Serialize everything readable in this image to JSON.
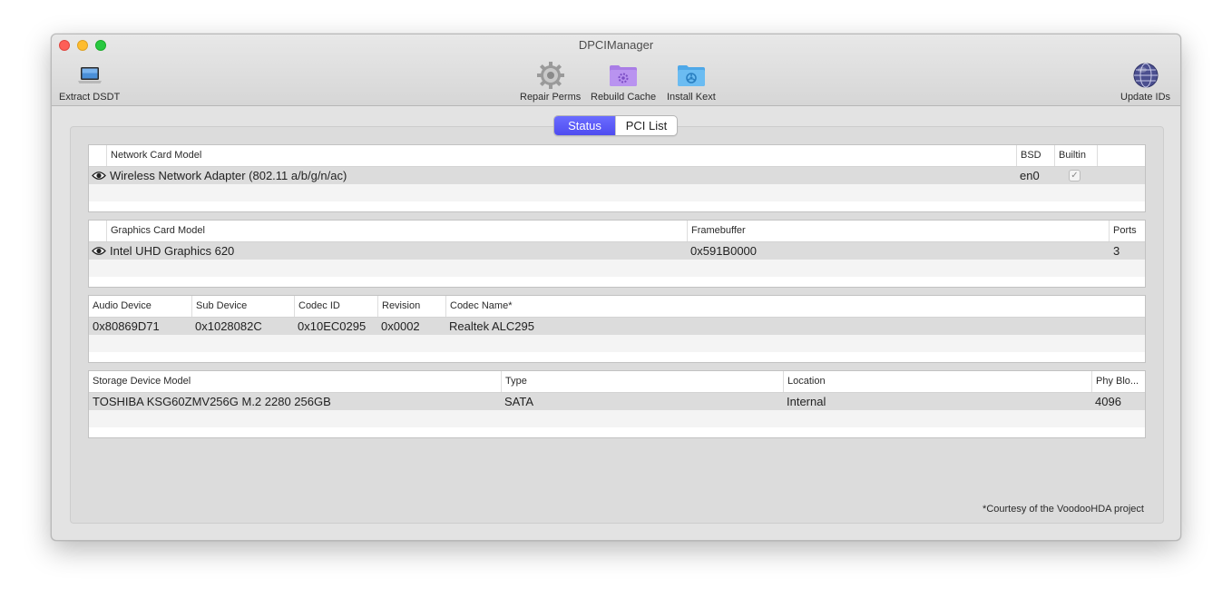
{
  "window": {
    "title": "DPCIManager"
  },
  "toolbar": {
    "extract_dsdt": {
      "label": "Extract DSDT",
      "icon": "laptop-icon"
    },
    "repair_perms": {
      "label": "Repair Perms",
      "icon": "gear-icon"
    },
    "rebuild_cache": {
      "label": "Rebuild Cache",
      "icon": "purple-folder-icon"
    },
    "install_kext": {
      "label": "Install Kext",
      "icon": "blue-folder-icon"
    },
    "update_ids": {
      "label": "Update IDs",
      "icon": "globe-icon"
    }
  },
  "tabs": {
    "status": "Status",
    "pci_list": "PCI List",
    "selected": "Status"
  },
  "network": {
    "headers": {
      "model": "Network Card Model",
      "bsd": "BSD",
      "builtin": "Builtin"
    },
    "rows": [
      {
        "model": "Wireless Network Adapter (802.11 a/b/g/n/ac)",
        "bsd": "en0",
        "builtin_mark": "✓"
      }
    ]
  },
  "graphics": {
    "headers": {
      "model": "Graphics Card Model",
      "framebuffer": "Framebuffer",
      "ports": "Ports"
    },
    "rows": [
      {
        "model": "Intel UHD Graphics 620",
        "framebuffer": "0x591B0000",
        "ports": "3"
      }
    ]
  },
  "audio": {
    "headers": {
      "device": "Audio Device",
      "sub_device": "Sub Device",
      "codec_id": "Codec ID",
      "revision": "Revision",
      "codec_name": "Codec Name*"
    },
    "rows": [
      {
        "device": "0x80869D71",
        "sub_device": "0x1028082C",
        "codec_id": "0x10EC0295",
        "revision": "0x0002",
        "codec_name": "Realtek ALC295"
      }
    ]
  },
  "storage": {
    "headers": {
      "model": "Storage Device Model",
      "type": "Type",
      "location": "Location",
      "phy_block": "Phy Blo..."
    },
    "rows": [
      {
        "model": "TOSHIBA KSG60ZMV256G M.2 2280 256GB",
        "type": "SATA",
        "location": "Internal",
        "phy_block": "4096"
      }
    ]
  },
  "footnote": "*Courtesy of the VoodooHDA project",
  "colors": {
    "accent": "#5b5bf5",
    "close": "#fe5f57",
    "minimize": "#febc2e",
    "maximize": "#28c840"
  }
}
